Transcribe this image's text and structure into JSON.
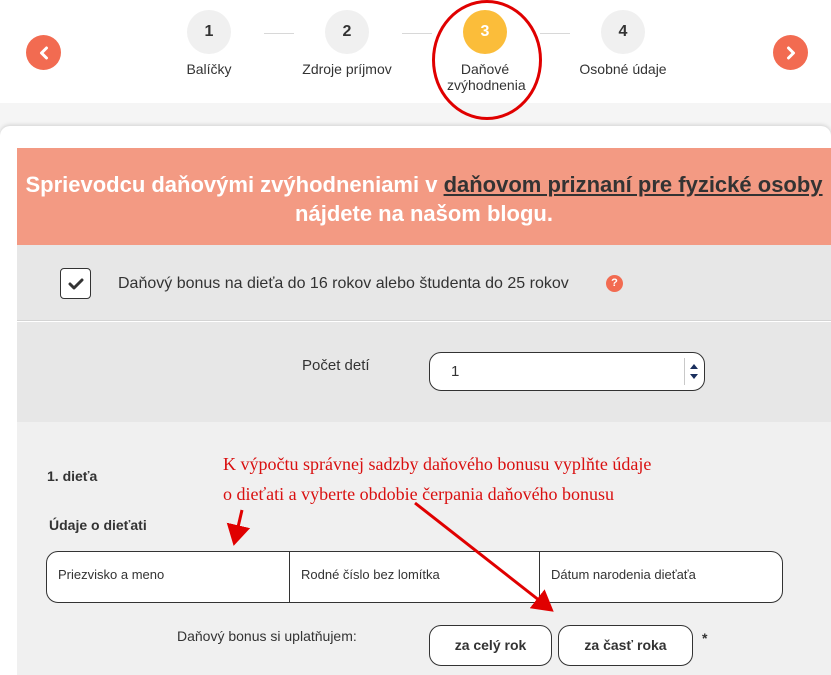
{
  "wizard": {
    "steps": [
      {
        "number": "1",
        "label": "Balíčky"
      },
      {
        "number": "2",
        "label": "Zdroje príjmov"
      },
      {
        "number": "3",
        "label": "Daňové zvýhodnenia"
      },
      {
        "number": "4",
        "label": "Osobné údaje"
      }
    ],
    "active_step": 3,
    "prev_icon": "chevron-left-icon",
    "next_icon": "chevron-right-icon",
    "accent_color": "#f26b51",
    "active_color": "#fbbd3a"
  },
  "banner": {
    "text_before": "Sprievodcu daňovými zvýhodneniami v ",
    "link_text": "daňovom priznaní pre fyzické osoby",
    "text_after": " nájdete na našom blogu.",
    "background": "#f39a83"
  },
  "child_bonus": {
    "checked": true,
    "label": "Daňový bonus na dieťa do 16 rokov alebo študenta do 25 rokov",
    "help": "?"
  },
  "children_count": {
    "label": "Počet detí",
    "value": "1"
  },
  "child": {
    "title": "1. dieťa",
    "subtitle": "Údaje o dieťati",
    "fields": {
      "name_placeholder": "Priezvisko a meno",
      "id_placeholder": "Rodné číslo bez lomítka",
      "birth_placeholder": "Dátum narodenia dieťaťa"
    },
    "bonus_label": "Daňový bonus si uplatňujem:",
    "option_full": "za celý rok",
    "option_part": "za časť roka",
    "required_mark": "*"
  },
  "annotation": {
    "line1": "K výpočtu správnej sadzby daňového bonusu vyplňte údaje",
    "line2": "o dieťati a vyberte obdobie čerpania daňového bonusu",
    "color": "#d91010"
  }
}
